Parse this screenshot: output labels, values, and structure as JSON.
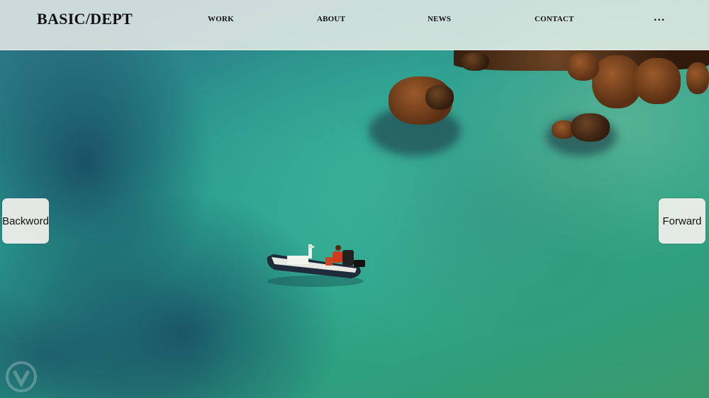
{
  "header": {
    "logo": "BASIC/DEPT",
    "nav": [
      "WORK",
      "ABOUT",
      "NEWS",
      "CONTACT"
    ],
    "more": "..."
  },
  "carousel": {
    "backward_label": "Backword",
    "forward_label": "Forward"
  },
  "colors": {
    "header_bg": "#f0f0ec",
    "button_bg": "#eeeeea",
    "text": "#111111",
    "sea": "#2aa38e"
  },
  "icons": [
    "boat-image",
    "watermark-icon"
  ]
}
